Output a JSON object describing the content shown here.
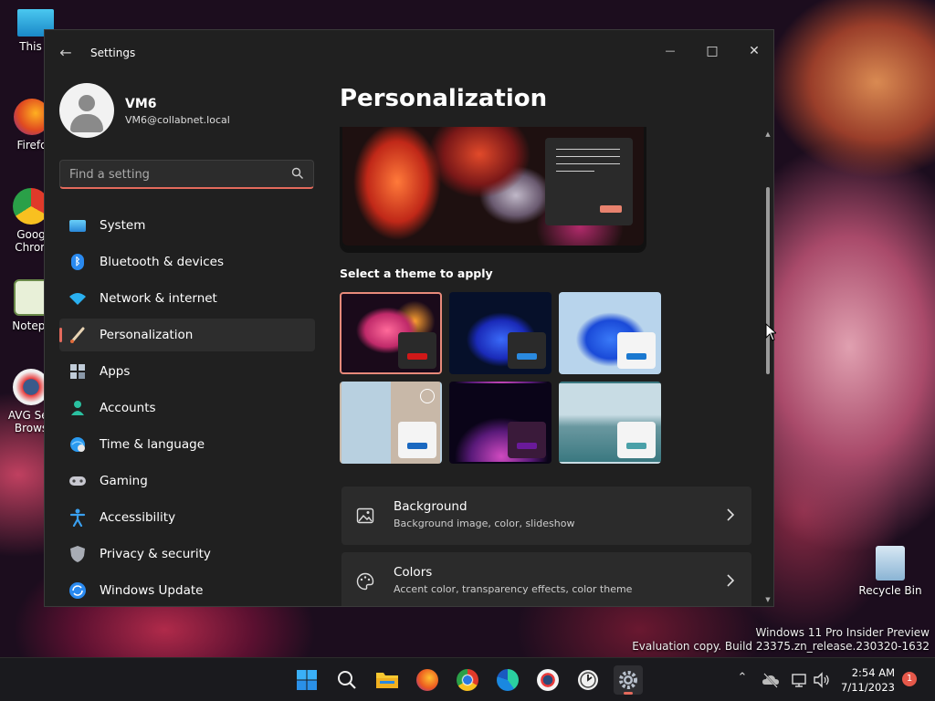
{
  "desktop": {
    "icons": [
      {
        "label": "This P"
      },
      {
        "label": "Firefo"
      },
      {
        "label": "Goog Chron"
      },
      {
        "label": "Notepa"
      },
      {
        "label": "AVG Sec Brows"
      },
      {
        "label": "Recycle Bin"
      }
    ],
    "watermark_line1": "Windows 11 Pro Insider Preview",
    "watermark_line2": "Evaluation copy. Build 23375.zn_release.230320-1632"
  },
  "window": {
    "title": "Settings",
    "back_icon": "back-arrow-icon",
    "controls": {
      "minimize": "—",
      "maximize": "□",
      "close": "✕"
    }
  },
  "user": {
    "name": "VM6",
    "email": "VM6@collabnet.local"
  },
  "search": {
    "placeholder": "Find a setting",
    "value": ""
  },
  "nav": {
    "items": [
      {
        "label": "System",
        "icon": "system-icon",
        "color": "#4aa8e8"
      },
      {
        "label": "Bluetooth & devices",
        "icon": "bluetooth-icon",
        "color": "#2a8af0"
      },
      {
        "label": "Network & internet",
        "icon": "wifi-icon",
        "color": "#2ab0f0"
      },
      {
        "label": "Personalization",
        "icon": "paintbrush-icon",
        "color": "#e0c8a0",
        "active": true
      },
      {
        "label": "Apps",
        "icon": "apps-icon",
        "color": "#b8c4d0"
      },
      {
        "label": "Accounts",
        "icon": "accounts-icon",
        "color": "#2ac0a0"
      },
      {
        "label": "Time & language",
        "icon": "globe-clock-icon",
        "color": "#2a9af0"
      },
      {
        "label": "Gaming",
        "icon": "gamepad-icon",
        "color": "#c8c8d0"
      },
      {
        "label": "Accessibility",
        "icon": "accessibility-icon",
        "color": "#3aa0f0"
      },
      {
        "label": "Privacy & security",
        "icon": "shield-icon",
        "color": "#a8acb4"
      },
      {
        "label": "Windows Update",
        "icon": "update-icon",
        "color": "#2a8af0"
      }
    ]
  },
  "main": {
    "title": "Personalization",
    "themes_label": "Select a theme to apply",
    "themes": [
      {
        "name": "theme-glow",
        "selected": true,
        "swatch": "#2a2a2a",
        "bar": "#d01818"
      },
      {
        "name": "theme-windows-dark",
        "swatch": "#2a2a2a",
        "bar": "#2a8ae0"
      },
      {
        "name": "theme-windows-light",
        "swatch": "#f4f4f4",
        "bar": "#1a78d0"
      },
      {
        "name": "theme-spotlight",
        "swatch": "#f4f4f4",
        "bar": "#1a68c0"
      },
      {
        "name": "theme-captured-motion",
        "swatch": "#3a1a3a",
        "bar": "#6a1a9a"
      },
      {
        "name": "theme-flow",
        "swatch": "#f4f4f4",
        "bar": "#4aa0a8"
      }
    ],
    "cards": [
      {
        "title": "Background",
        "subtitle": "Background image, color, slideshow",
        "icon": "picture-icon"
      },
      {
        "title": "Colors",
        "subtitle": "Accent color, transparency effects, color theme",
        "icon": "palette-icon"
      }
    ]
  },
  "taskbar": {
    "apps": [
      {
        "name": "start-button",
        "icon": "windows-logo-icon"
      },
      {
        "name": "search-button",
        "icon": "search-icon"
      },
      {
        "name": "file-explorer-button",
        "icon": "folder-icon"
      },
      {
        "name": "firefox-button",
        "icon": "firefox-icon"
      },
      {
        "name": "chrome-button",
        "icon": "chrome-icon"
      },
      {
        "name": "edge-button",
        "icon": "edge-icon"
      },
      {
        "name": "avg-browser-button",
        "icon": "avg-browser-icon"
      },
      {
        "name": "clock-app-button",
        "icon": "clock-icon"
      },
      {
        "name": "settings-taskbar-button",
        "icon": "gear-icon",
        "active": true
      }
    ],
    "time": "2:54 AM",
    "date": "7/11/2023",
    "notification_count": "1"
  }
}
